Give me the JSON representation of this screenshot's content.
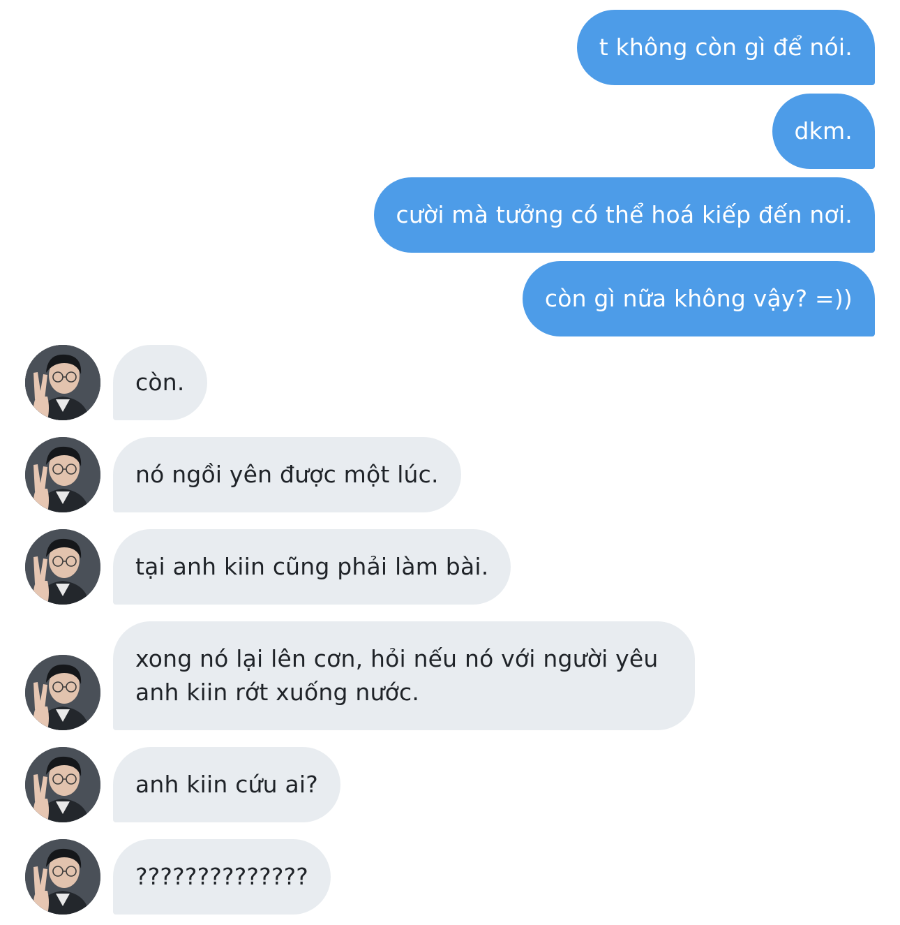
{
  "conversation": {
    "sent": [
      {
        "text": "t không còn gì để nói."
      },
      {
        "text": "dkm."
      },
      {
        "text": "cười mà tưởng có thể hoá kiếp đến nơi."
      },
      {
        "text": "còn gì nữa không vậy? =))"
      }
    ],
    "received": [
      {
        "text": "còn."
      },
      {
        "text": "nó ngồi yên được một lúc."
      },
      {
        "text": "tại anh kiin cũng phải làm bài."
      },
      {
        "text": "xong nó lại lên cơn, hỏi nếu nó với người yêu anh kiin rớt xuống nước."
      },
      {
        "text": "anh kiin cứu ai?"
      },
      {
        "text": "??????????????"
      }
    ]
  },
  "colors": {
    "sent_bubble": "#4d9ce8",
    "received_bubble": "#e8ecf0",
    "sent_text": "#ffffff",
    "received_text": "#1f2328"
  },
  "icons": {
    "avatar": "contact-avatar-icon"
  }
}
